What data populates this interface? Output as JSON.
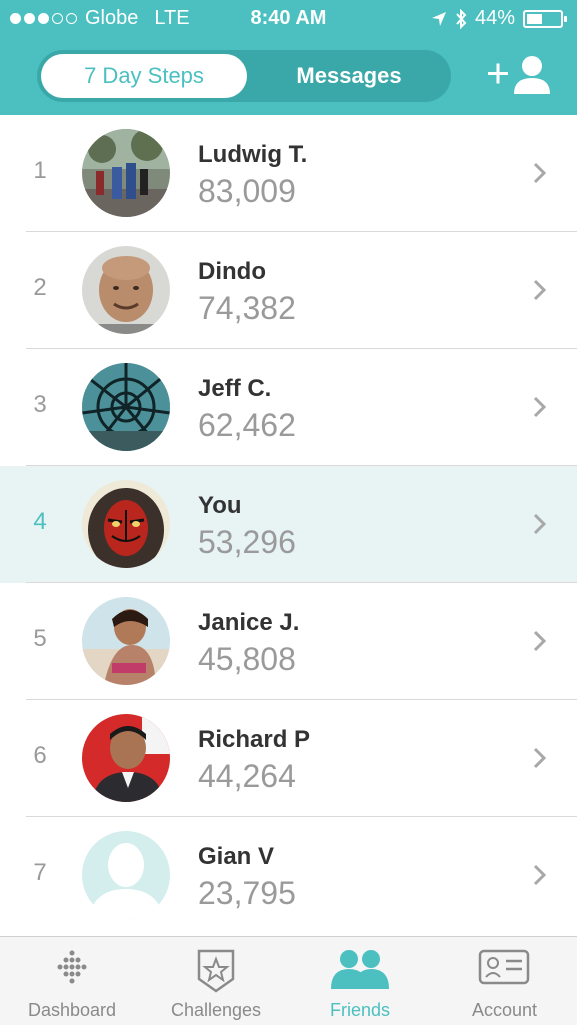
{
  "status": {
    "carrier": "Globe",
    "network": "LTE",
    "time": "8:40 AM",
    "battery": "44%",
    "signal_bars_filled": 3,
    "signal_bars_total": 5
  },
  "header": {
    "tabs": [
      {
        "label": "7 Day Steps",
        "active": true
      },
      {
        "label": "Messages",
        "active": false
      }
    ],
    "add_friend_icon": "add-person-icon",
    "accent_color": "#4cc0c0"
  },
  "leaderboard": [
    {
      "rank": "1",
      "name": "Ludwig T.",
      "steps": "83,009"
    },
    {
      "rank": "2",
      "name": "Dindo",
      "steps": "74,382"
    },
    {
      "rank": "3",
      "name": "Jeff C.",
      "steps": "62,462"
    },
    {
      "rank": "4",
      "name": "You",
      "steps": "53,296",
      "highlighted": true
    },
    {
      "rank": "5",
      "name": "Janice J.",
      "steps": "45,808"
    },
    {
      "rank": "6",
      "name": "Richard P",
      "steps": "44,264"
    },
    {
      "rank": "7",
      "name": "Gian V",
      "steps": "23,795"
    }
  ],
  "tabbar": [
    {
      "label": "Dashboard",
      "icon": "fitbit-dots-icon"
    },
    {
      "label": "Challenges",
      "icon": "star-badge-icon"
    },
    {
      "label": "Friends",
      "icon": "friends-icon",
      "active": true
    },
    {
      "label": "Account",
      "icon": "id-card-icon"
    }
  ]
}
